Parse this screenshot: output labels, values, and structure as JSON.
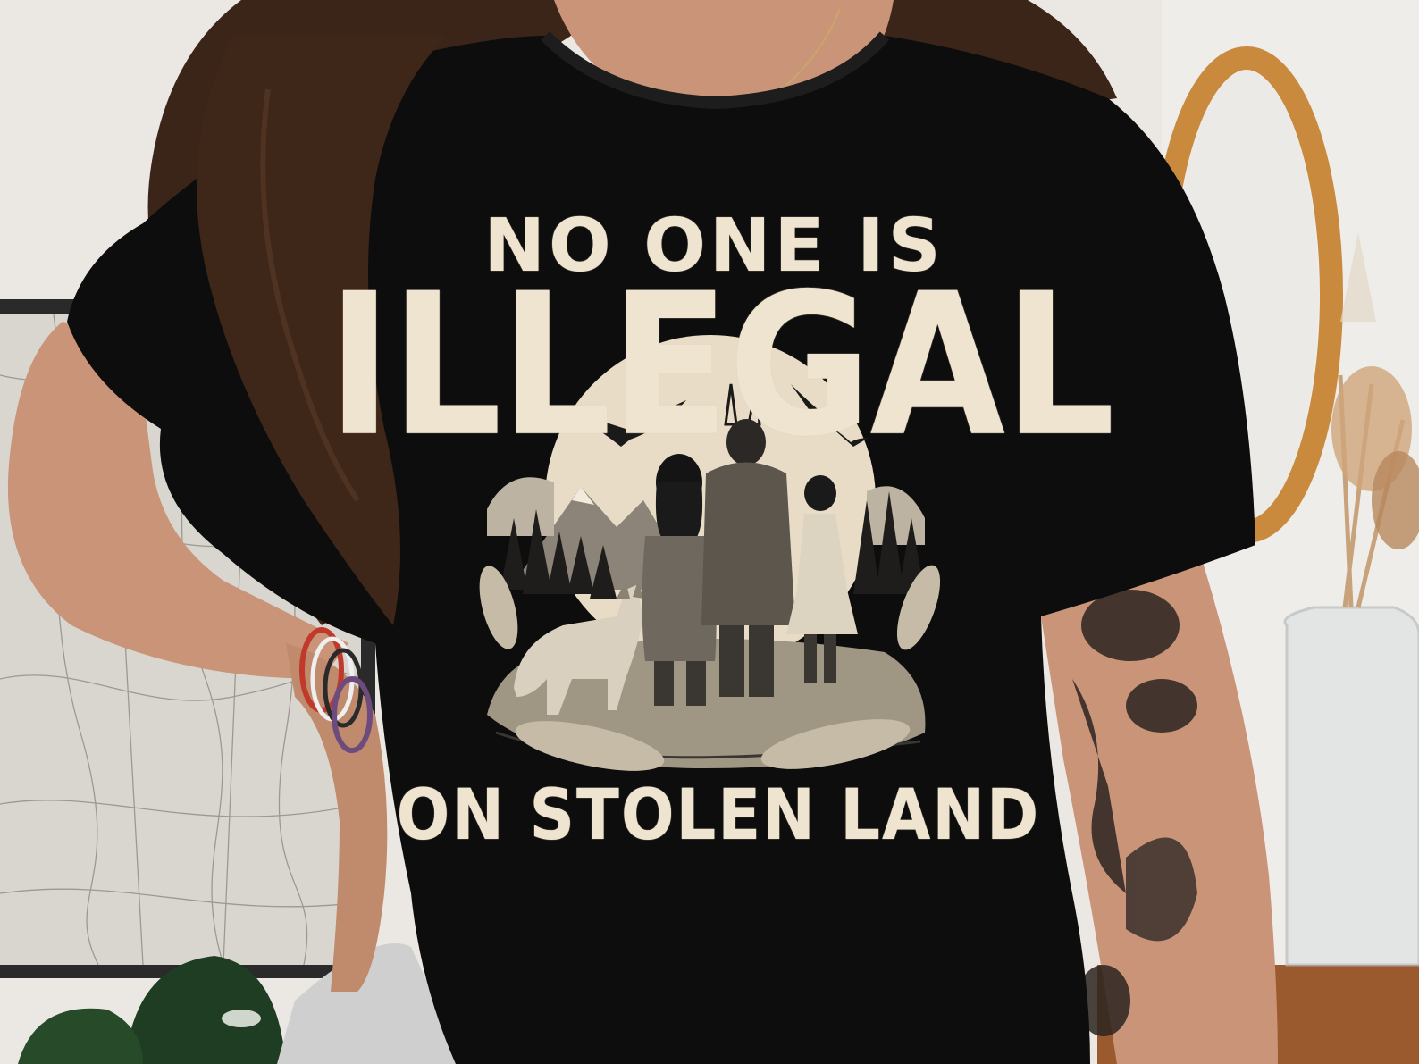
{
  "shirt_print": {
    "line1": "NO ONE IS",
    "line2": "ILLEGAL",
    "line3": "ON STOLEN LAND"
  },
  "colors": {
    "wall": "#e9e6e1",
    "shirt": "#0d0d0d",
    "print_ink": "#efe4cf",
    "hair": "#3b2418",
    "skin": "#c99478",
    "mirror_frame": "#c98a3e"
  }
}
